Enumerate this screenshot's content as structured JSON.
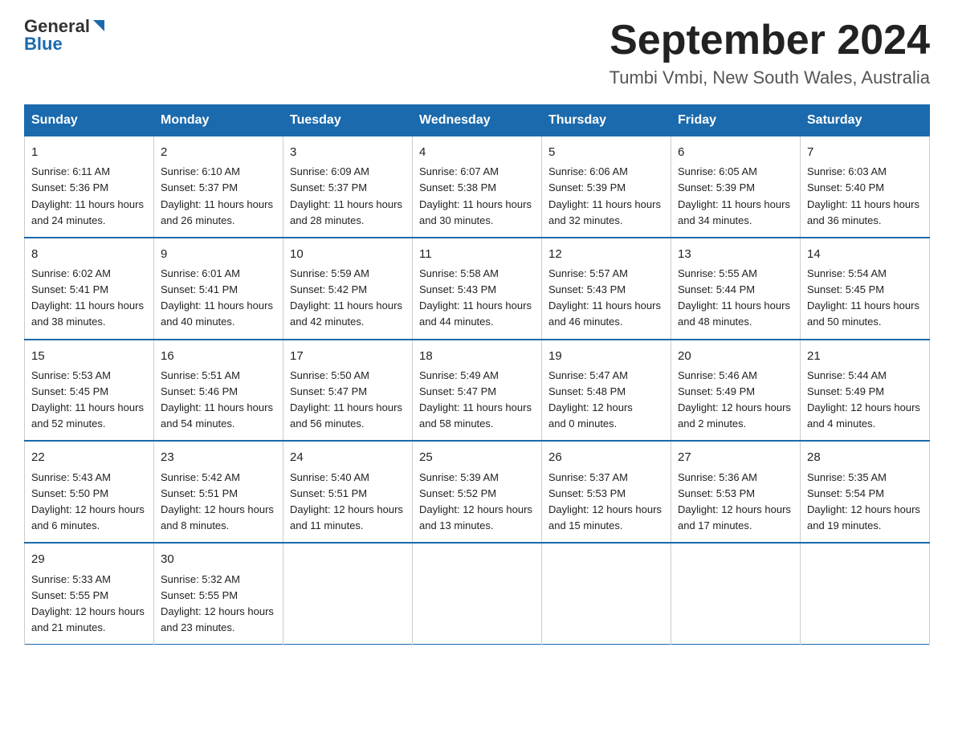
{
  "header": {
    "logo_general": "General",
    "logo_blue": "Blue",
    "month_title": "September 2024",
    "location": "Tumbi Vmbi, New South Wales, Australia"
  },
  "weekdays": [
    "Sunday",
    "Monday",
    "Tuesday",
    "Wednesday",
    "Thursday",
    "Friday",
    "Saturday"
  ],
  "weeks": [
    [
      {
        "day": "1",
        "sunrise": "6:11 AM",
        "sunset": "5:36 PM",
        "daylight": "11 hours and 24 minutes."
      },
      {
        "day": "2",
        "sunrise": "6:10 AM",
        "sunset": "5:37 PM",
        "daylight": "11 hours and 26 minutes."
      },
      {
        "day": "3",
        "sunrise": "6:09 AM",
        "sunset": "5:37 PM",
        "daylight": "11 hours and 28 minutes."
      },
      {
        "day": "4",
        "sunrise": "6:07 AM",
        "sunset": "5:38 PM",
        "daylight": "11 hours and 30 minutes."
      },
      {
        "day": "5",
        "sunrise": "6:06 AM",
        "sunset": "5:39 PM",
        "daylight": "11 hours and 32 minutes."
      },
      {
        "day": "6",
        "sunrise": "6:05 AM",
        "sunset": "5:39 PM",
        "daylight": "11 hours and 34 minutes."
      },
      {
        "day": "7",
        "sunrise": "6:03 AM",
        "sunset": "5:40 PM",
        "daylight": "11 hours and 36 minutes."
      }
    ],
    [
      {
        "day": "8",
        "sunrise": "6:02 AM",
        "sunset": "5:41 PM",
        "daylight": "11 hours and 38 minutes."
      },
      {
        "day": "9",
        "sunrise": "6:01 AM",
        "sunset": "5:41 PM",
        "daylight": "11 hours and 40 minutes."
      },
      {
        "day": "10",
        "sunrise": "5:59 AM",
        "sunset": "5:42 PM",
        "daylight": "11 hours and 42 minutes."
      },
      {
        "day": "11",
        "sunrise": "5:58 AM",
        "sunset": "5:43 PM",
        "daylight": "11 hours and 44 minutes."
      },
      {
        "day": "12",
        "sunrise": "5:57 AM",
        "sunset": "5:43 PM",
        "daylight": "11 hours and 46 minutes."
      },
      {
        "day": "13",
        "sunrise": "5:55 AM",
        "sunset": "5:44 PM",
        "daylight": "11 hours and 48 minutes."
      },
      {
        "day": "14",
        "sunrise": "5:54 AM",
        "sunset": "5:45 PM",
        "daylight": "11 hours and 50 minutes."
      }
    ],
    [
      {
        "day": "15",
        "sunrise": "5:53 AM",
        "sunset": "5:45 PM",
        "daylight": "11 hours and 52 minutes."
      },
      {
        "day": "16",
        "sunrise": "5:51 AM",
        "sunset": "5:46 PM",
        "daylight": "11 hours and 54 minutes."
      },
      {
        "day": "17",
        "sunrise": "5:50 AM",
        "sunset": "5:47 PM",
        "daylight": "11 hours and 56 minutes."
      },
      {
        "day": "18",
        "sunrise": "5:49 AM",
        "sunset": "5:47 PM",
        "daylight": "11 hours and 58 minutes."
      },
      {
        "day": "19",
        "sunrise": "5:47 AM",
        "sunset": "5:48 PM",
        "daylight": "12 hours and 0 minutes."
      },
      {
        "day": "20",
        "sunrise": "5:46 AM",
        "sunset": "5:49 PM",
        "daylight": "12 hours and 2 minutes."
      },
      {
        "day": "21",
        "sunrise": "5:44 AM",
        "sunset": "5:49 PM",
        "daylight": "12 hours and 4 minutes."
      }
    ],
    [
      {
        "day": "22",
        "sunrise": "5:43 AM",
        "sunset": "5:50 PM",
        "daylight": "12 hours and 6 minutes."
      },
      {
        "day": "23",
        "sunrise": "5:42 AM",
        "sunset": "5:51 PM",
        "daylight": "12 hours and 8 minutes."
      },
      {
        "day": "24",
        "sunrise": "5:40 AM",
        "sunset": "5:51 PM",
        "daylight": "12 hours and 11 minutes."
      },
      {
        "day": "25",
        "sunrise": "5:39 AM",
        "sunset": "5:52 PM",
        "daylight": "12 hours and 13 minutes."
      },
      {
        "day": "26",
        "sunrise": "5:37 AM",
        "sunset": "5:53 PM",
        "daylight": "12 hours and 15 minutes."
      },
      {
        "day": "27",
        "sunrise": "5:36 AM",
        "sunset": "5:53 PM",
        "daylight": "12 hours and 17 minutes."
      },
      {
        "day": "28",
        "sunrise": "5:35 AM",
        "sunset": "5:54 PM",
        "daylight": "12 hours and 19 minutes."
      }
    ],
    [
      {
        "day": "29",
        "sunrise": "5:33 AM",
        "sunset": "5:55 PM",
        "daylight": "12 hours and 21 minutes."
      },
      {
        "day": "30",
        "sunrise": "5:32 AM",
        "sunset": "5:55 PM",
        "daylight": "12 hours and 23 minutes."
      },
      null,
      null,
      null,
      null,
      null
    ]
  ],
  "labels": {
    "sunrise": "Sunrise:",
    "sunset": "Sunset:",
    "daylight": "Daylight:"
  }
}
